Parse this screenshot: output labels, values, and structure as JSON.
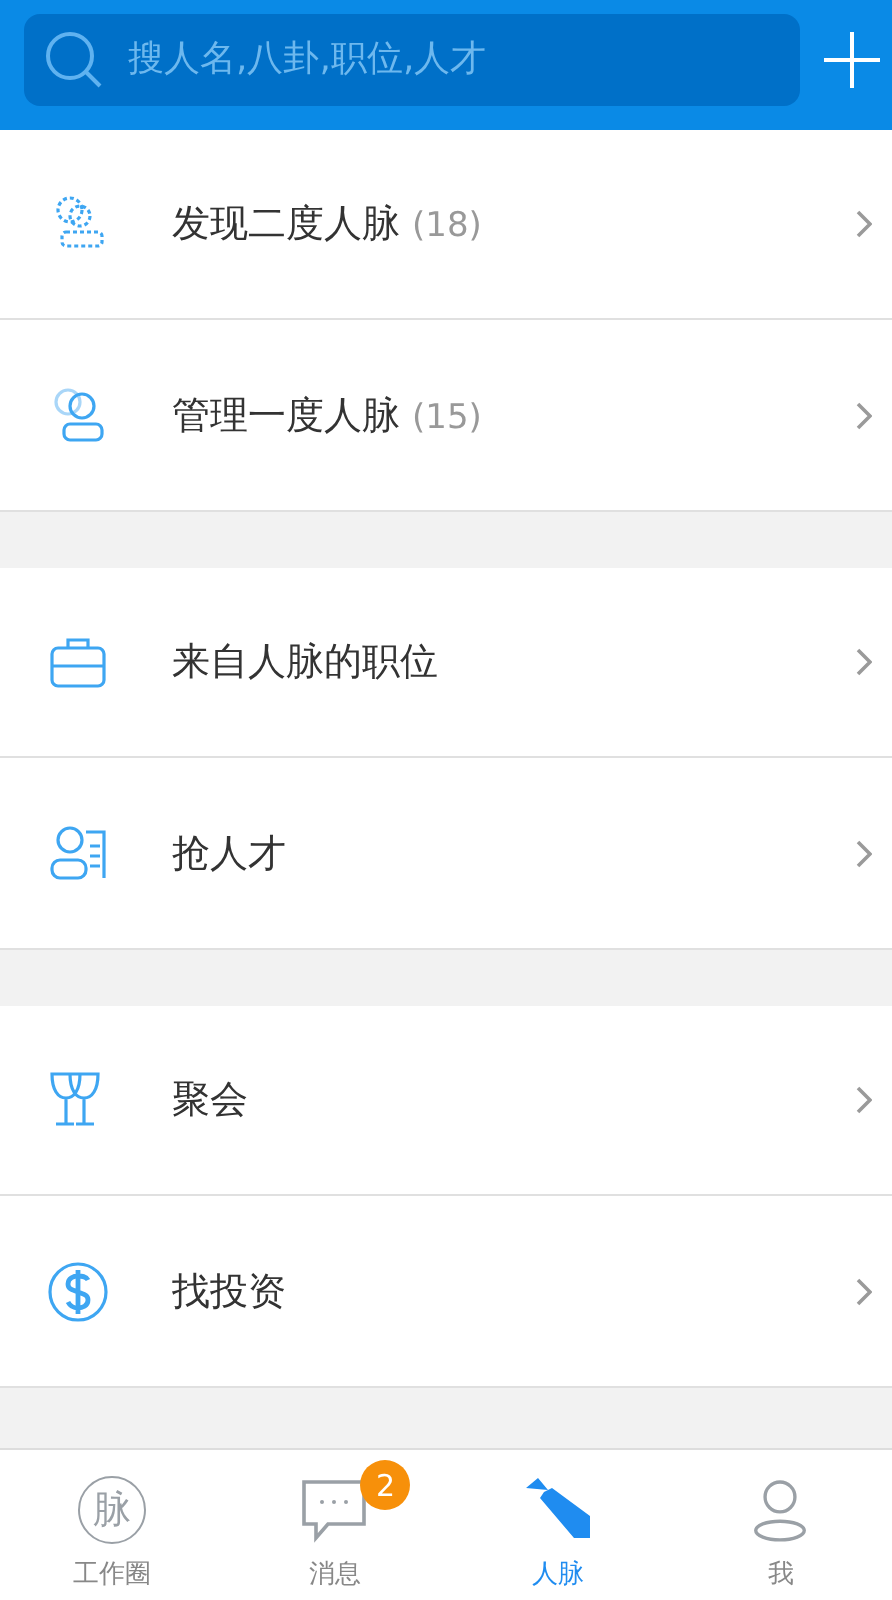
{
  "search": {
    "placeholder": "搜人名,八卦,职位,人才"
  },
  "groups": [
    {
      "items": [
        {
          "title": "发现二度人脉",
          "count": "(18)"
        },
        {
          "title": "管理一度人脉",
          "count": "(15)"
        }
      ]
    },
    {
      "items": [
        {
          "title": "来自人脉的职位"
        },
        {
          "title": "抢人才"
        }
      ]
    },
    {
      "items": [
        {
          "title": "聚会"
        },
        {
          "title": "找投资"
        }
      ]
    }
  ],
  "tabs": [
    {
      "icon_text": "脉",
      "label": "工作圈",
      "selected": false
    },
    {
      "label": "消息",
      "badge": "2",
      "selected": false
    },
    {
      "label": "人脉",
      "selected": true
    },
    {
      "label": "我",
      "selected": false
    }
  ]
}
